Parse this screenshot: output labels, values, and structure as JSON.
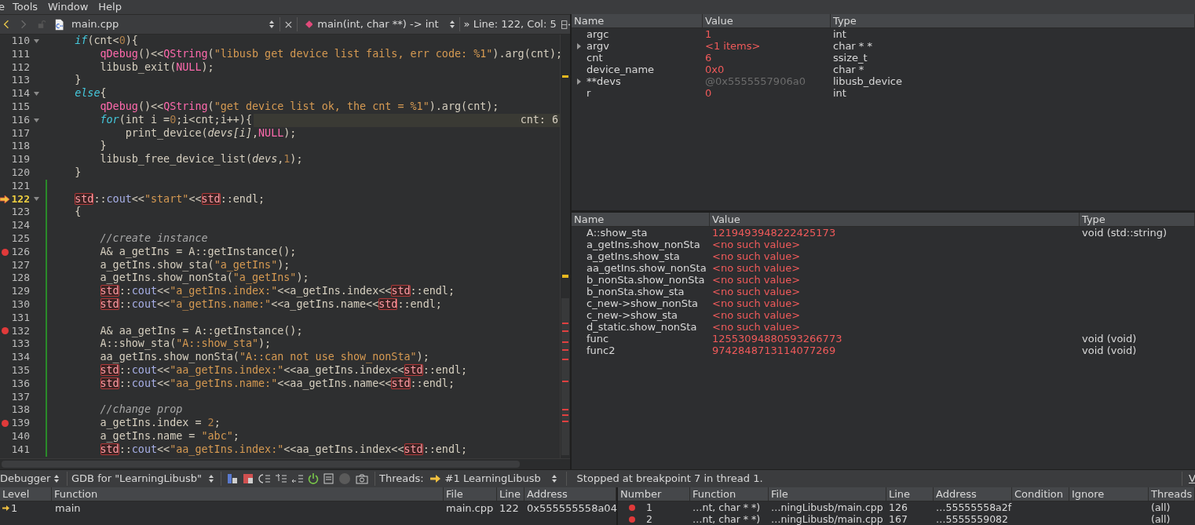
{
  "menu": [
    "e",
    "Tools",
    "Window",
    "Help"
  ],
  "editor_toolbar": {
    "file": "main.cpp",
    "function": "main(int, char **) -> int",
    "position": "» Line: 122, Col: 5"
  },
  "editor": {
    "lines": [
      {
        "number": "110",
        "breakpoint": false,
        "current": false,
        "foldable": true,
        "tokens": [
          {
            "kind": "kw",
            "text": "    if"
          },
          {
            "kind": "plain",
            "text": "(cnt<"
          },
          {
            "kind": "num",
            "text": "0"
          },
          {
            "kind": "plain",
            "text": "){"
          }
        ]
      },
      {
        "number": "111",
        "breakpoint": false,
        "current": false,
        "foldable": false,
        "tokens": [
          {
            "kind": "fn",
            "text": "        qDebug"
          },
          {
            "kind": "plain",
            "text": "()<<"
          },
          {
            "kind": "fn",
            "text": "QString"
          },
          {
            "kind": "plain",
            "text": "("
          },
          {
            "kind": "str",
            "text": "\"libusb get device list fails, err code: %1\""
          },
          {
            "kind": "plain",
            "text": ").arg(cnt);"
          }
        ]
      },
      {
        "number": "112",
        "breakpoint": false,
        "current": false,
        "foldable": false,
        "tokens": [
          {
            "kind": "plain",
            "text": "        libusb_exit("
          },
          {
            "kind": "fn",
            "text": "NULL"
          },
          {
            "kind": "plain",
            "text": ");"
          }
        ]
      },
      {
        "number": "113",
        "breakpoint": false,
        "current": false,
        "foldable": false,
        "tokens": [
          {
            "kind": "plain",
            "text": "    }"
          }
        ]
      },
      {
        "number": "114",
        "breakpoint": false,
        "current": false,
        "foldable": true,
        "tokens": [
          {
            "kind": "kw",
            "text": "    else"
          },
          {
            "kind": "plain",
            "text": "{"
          }
        ]
      },
      {
        "number": "115",
        "breakpoint": false,
        "current": false,
        "foldable": false,
        "tokens": [
          {
            "kind": "fn",
            "text": "        qDebug"
          },
          {
            "kind": "plain",
            "text": "()<<"
          },
          {
            "kind": "fn",
            "text": "QString"
          },
          {
            "kind": "plain",
            "text": "("
          },
          {
            "kind": "str",
            "text": "\"get device list ok, the cnt = %1\""
          },
          {
            "kind": "plain",
            "text": ").arg(cnt);"
          }
        ]
      },
      {
        "number": "116",
        "breakpoint": false,
        "current": false,
        "foldable": true,
        "annotation": "cnt: 6",
        "tokens": [
          {
            "kind": "kw",
            "text": "        for"
          },
          {
            "kind": "plain",
            "text": "(int i ="
          },
          {
            "kind": "num",
            "text": "0"
          },
          {
            "kind": "plain",
            "text": ";i<cnt;i++){"
          }
        ]
      },
      {
        "number": "117",
        "breakpoint": false,
        "current": false,
        "foldable": false,
        "tokens": [
          {
            "kind": "plain",
            "text": "            print_device("
          },
          {
            "kind": "ital",
            "text": "devs[i]"
          },
          {
            "kind": "plain",
            "text": ","
          },
          {
            "kind": "fn",
            "text": "NULL"
          },
          {
            "kind": "plain",
            "text": ");"
          }
        ]
      },
      {
        "number": "118",
        "breakpoint": false,
        "current": false,
        "foldable": false,
        "tokens": [
          {
            "kind": "plain",
            "text": "        }"
          }
        ]
      },
      {
        "number": "119",
        "breakpoint": false,
        "current": false,
        "foldable": false,
        "tokens": [
          {
            "kind": "plain",
            "text": "        libusb_free_device_list("
          },
          {
            "kind": "ital",
            "text": "devs"
          },
          {
            "kind": "plain",
            "text": ","
          },
          {
            "kind": "num",
            "text": "1"
          },
          {
            "kind": "plain",
            "text": ");"
          }
        ]
      },
      {
        "number": "120",
        "breakpoint": false,
        "current": false,
        "foldable": false,
        "tokens": [
          {
            "kind": "plain",
            "text": "    }"
          }
        ]
      },
      {
        "number": "121",
        "breakpoint": false,
        "current": false,
        "foldable": false
      },
      {
        "number": "122",
        "breakpoint": false,
        "current": true,
        "foldable": true,
        "tokens": [
          {
            "kind": "box",
            "text": "    std"
          },
          {
            "kind": "plain",
            "text": "::"
          },
          {
            "kind": "cout",
            "text": "cout"
          },
          {
            "kind": "plain",
            "text": "<<"
          },
          {
            "kind": "str",
            "text": "\"start\""
          },
          {
            "kind": "plain",
            "text": "<<"
          },
          {
            "kind": "box",
            "text": "std"
          },
          {
            "kind": "plain",
            "text": "::endl;"
          }
        ]
      },
      {
        "number": "123",
        "breakpoint": false,
        "current": false,
        "foldable": false,
        "tokens": [
          {
            "kind": "plain",
            "text": "    {"
          }
        ]
      },
      {
        "number": "124",
        "breakpoint": false,
        "current": false,
        "foldable": false
      },
      {
        "number": "125",
        "breakpoint": false,
        "current": false,
        "foldable": false,
        "tokens": [
          {
            "kind": "comment",
            "text": "        //create instance"
          }
        ]
      },
      {
        "number": "126",
        "breakpoint": true,
        "current": false,
        "foldable": false,
        "tokens": [
          {
            "kind": "plain",
            "text": "        A& a_getIns = A::getInstance();"
          }
        ]
      },
      {
        "number": "127",
        "breakpoint": false,
        "current": false,
        "foldable": false,
        "tokens": [
          {
            "kind": "plain",
            "text": "        a_getIns.show_sta("
          },
          {
            "kind": "str",
            "text": "\"a_getIns\""
          },
          {
            "kind": "plain",
            "text": ");"
          }
        ]
      },
      {
        "number": "128",
        "breakpoint": false,
        "current": false,
        "foldable": false,
        "tokens": [
          {
            "kind": "plain",
            "text": "        a_getIns.show_nonSta("
          },
          {
            "kind": "str",
            "text": "\"a_getIns\""
          },
          {
            "kind": "plain",
            "text": ");"
          }
        ]
      },
      {
        "number": "129",
        "breakpoint": false,
        "current": false,
        "foldable": false,
        "tokens": [
          {
            "kind": "box",
            "text": "        std"
          },
          {
            "kind": "plain",
            "text": "::"
          },
          {
            "kind": "cout",
            "text": "cout"
          },
          {
            "kind": "plain",
            "text": "<<"
          },
          {
            "kind": "str",
            "text": "\"a_getIns.index:\""
          },
          {
            "kind": "plain",
            "text": "<<a_getIns.index<<"
          },
          {
            "kind": "box",
            "text": "std"
          },
          {
            "kind": "plain",
            "text": "::endl;"
          }
        ]
      },
      {
        "number": "130",
        "breakpoint": false,
        "current": false,
        "foldable": false,
        "tokens": [
          {
            "kind": "box",
            "text": "        std"
          },
          {
            "kind": "plain",
            "text": "::"
          },
          {
            "kind": "cout",
            "text": "cout"
          },
          {
            "kind": "plain",
            "text": "<<"
          },
          {
            "kind": "str",
            "text": "\"a_getIns.name:\""
          },
          {
            "kind": "plain",
            "text": "<<a_getIns.name<<"
          },
          {
            "kind": "box",
            "text": "std"
          },
          {
            "kind": "plain",
            "text": "::endl;"
          }
        ]
      },
      {
        "number": "131",
        "breakpoint": false,
        "current": false,
        "foldable": false
      },
      {
        "number": "132",
        "breakpoint": true,
        "current": false,
        "foldable": false,
        "tokens": [
          {
            "kind": "plain",
            "text": "        A& aa_getIns = A::getInstance();"
          }
        ]
      },
      {
        "number": "133",
        "breakpoint": false,
        "current": false,
        "foldable": false,
        "tokens": [
          {
            "kind": "plain",
            "text": "        A::show_sta("
          },
          {
            "kind": "str",
            "text": "\"A::show_sta\""
          },
          {
            "kind": "plain",
            "text": ");"
          }
        ]
      },
      {
        "number": "134",
        "breakpoint": false,
        "current": false,
        "foldable": false,
        "tokens": [
          {
            "kind": "plain",
            "text": "        aa_getIns.show_nonSta("
          },
          {
            "kind": "str",
            "text": "\"A::can not use show_nonSta\""
          },
          {
            "kind": "plain",
            "text": ");"
          }
        ]
      },
      {
        "number": "135",
        "breakpoint": false,
        "current": false,
        "foldable": false,
        "tokens": [
          {
            "kind": "box",
            "text": "        std"
          },
          {
            "kind": "plain",
            "text": "::"
          },
          {
            "kind": "cout",
            "text": "cout"
          },
          {
            "kind": "plain",
            "text": "<<"
          },
          {
            "kind": "str",
            "text": "\"aa_getIns.index:\""
          },
          {
            "kind": "plain",
            "text": "<<aa_getIns.index<<"
          },
          {
            "kind": "box",
            "text": "std"
          },
          {
            "kind": "plain",
            "text": "::endl;"
          }
        ]
      },
      {
        "number": "136",
        "breakpoint": false,
        "current": false,
        "foldable": false,
        "tokens": [
          {
            "kind": "box",
            "text": "        std"
          },
          {
            "kind": "plain",
            "text": "::"
          },
          {
            "kind": "cout",
            "text": "cout"
          },
          {
            "kind": "plain",
            "text": "<<"
          },
          {
            "kind": "str",
            "text": "\"aa_getIns.name:\""
          },
          {
            "kind": "plain",
            "text": "<<aa_getIns.name<<"
          },
          {
            "kind": "box",
            "text": "std"
          },
          {
            "kind": "plain",
            "text": "::endl;"
          }
        ]
      },
      {
        "number": "137",
        "breakpoint": false,
        "current": false,
        "foldable": false
      },
      {
        "number": "138",
        "breakpoint": false,
        "current": false,
        "foldable": false,
        "tokens": [
          {
            "kind": "comment",
            "text": "        //change prop"
          }
        ]
      },
      {
        "number": "139",
        "breakpoint": true,
        "current": false,
        "foldable": false,
        "tokens": [
          {
            "kind": "plain",
            "text": "        a_getIns.index = "
          },
          {
            "kind": "num",
            "text": "2"
          },
          {
            "kind": "plain",
            "text": ";"
          }
        ]
      },
      {
        "number": "140",
        "breakpoint": false,
        "current": false,
        "foldable": false,
        "tokens": [
          {
            "kind": "plain",
            "text": "        a_getIns.name = "
          },
          {
            "kind": "str",
            "text": "\"abc\""
          },
          {
            "kind": "plain",
            "text": ";"
          }
        ]
      },
      {
        "number": "141",
        "breakpoint": false,
        "current": false,
        "foldable": false,
        "tokens": [
          {
            "kind": "box",
            "text": "        std"
          },
          {
            "kind": "plain",
            "text": "::"
          },
          {
            "kind": "cout",
            "text": "cout"
          },
          {
            "kind": "plain",
            "text": "<<"
          },
          {
            "kind": "str",
            "text": "\"aa_getIns.index:\""
          },
          {
            "kind": "plain",
            "text": "<<aa_getIns.index<<"
          },
          {
            "kind": "box",
            "text": "std"
          },
          {
            "kind": "plain",
            "text": "::endl;"
          }
        ]
      }
    ]
  },
  "locals": {
    "columns": [
      "Name",
      "Value",
      "Type"
    ],
    "rows": [
      {
        "name": "argc",
        "value": "1",
        "type": "int",
        "expandable": false,
        "changed": true
      },
      {
        "name": "argv",
        "value": "<1 items>",
        "type": "char * *",
        "expandable": true,
        "changed": true
      },
      {
        "name": "cnt",
        "value": "6",
        "type": "ssize_t",
        "expandable": false,
        "changed": true
      },
      {
        "name": "device_name",
        "value": "0x0",
        "type": "char *",
        "expandable": false,
        "changed": true
      },
      {
        "name": "**devs",
        "value": "@0x5555557906a0",
        "type": "libusb_device",
        "expandable": true,
        "changed": false
      },
      {
        "name": "r",
        "value": "0",
        "type": "int",
        "expandable": false,
        "changed": true
      }
    ]
  },
  "expressions": {
    "columns": [
      "Name",
      "Value",
      "Type"
    ],
    "rows": [
      {
        "name": "A::show_sta",
        "value": "1219493948222425173",
        "type": "void (std::string)"
      },
      {
        "name": "a_getIns.show_nonSta",
        "value": "<no such value>"
      },
      {
        "name": "a_getIns.show_sta",
        "value": "<no such value>"
      },
      {
        "name": "aa_getIns.show_nonSta",
        "value": "<no such value>"
      },
      {
        "name": "b_nonSta.show_nonSta",
        "value": "<no such value>"
      },
      {
        "name": "b_nonSta.show_sta",
        "value": "<no such value>"
      },
      {
        "name": "c_new->show_nonSta",
        "value": "<no such value>"
      },
      {
        "name": "c_new->show_sta",
        "value": "<no such value>"
      },
      {
        "name": "d_static.show_nonSta",
        "value": "<no such value>"
      },
      {
        "name": "func",
        "value": "12553094880593266773",
        "type": "void (void)"
      },
      {
        "name": "func2",
        "value": "9742848713114077269",
        "type": "void (void)"
      }
    ]
  },
  "debug_toolbar": {
    "mode": "Debugger",
    "engine": "GDB for \"LearningLibusb\"",
    "threads_label": "Threads:",
    "thread": "#1 LearningLibusb",
    "status": "Stopped at breakpoint 7 in thread 1.",
    "view_button": "V"
  },
  "stack": {
    "columns": [
      "Level",
      "Function",
      "File",
      "Line",
      "Address"
    ],
    "rows": [
      {
        "level": "1",
        "function": "main",
        "file": "main.cpp",
        "line": "122",
        "address": "0x555555558a04",
        "current": true
      }
    ]
  },
  "breakpoints": {
    "columns": [
      "Number",
      "Function",
      "File",
      "Line",
      "Address",
      "Condition",
      "Ignore",
      "Threads"
    ],
    "rows": [
      {
        "number": "1",
        "function": "…nt, char * *)",
        "file": "…ningLibusb/main.cpp",
        "line": "126",
        "address": "…55555558a2f",
        "threads": "(all)",
        "enabled": true
      },
      {
        "number": "2",
        "function": "…nt, char * *)",
        "file": "…ningLibusb/main.cpp",
        "line": "167",
        "address": "…5555559082",
        "threads": "(all)",
        "enabled": true
      }
    ]
  }
}
